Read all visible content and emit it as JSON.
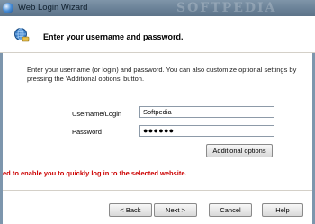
{
  "window": {
    "title": "Web Login Wizard",
    "watermark": "SOFTPEDIA"
  },
  "header": {
    "heading": "Enter your username and password."
  },
  "description": "Enter your username (or login) and password. You can also customize optional settings by pressing the 'Additional options' button.",
  "form": {
    "username_label": "Username/Login",
    "username_value": "Softpedia",
    "password_label": "Password",
    "password_value": "●●●●●●"
  },
  "buttons": {
    "additional_options": "Additional options",
    "back": "< Back",
    "next": "Next >",
    "cancel": "Cancel",
    "help": "Help"
  },
  "status_text": "ed to enable you to quickly log in to the selected website."
}
